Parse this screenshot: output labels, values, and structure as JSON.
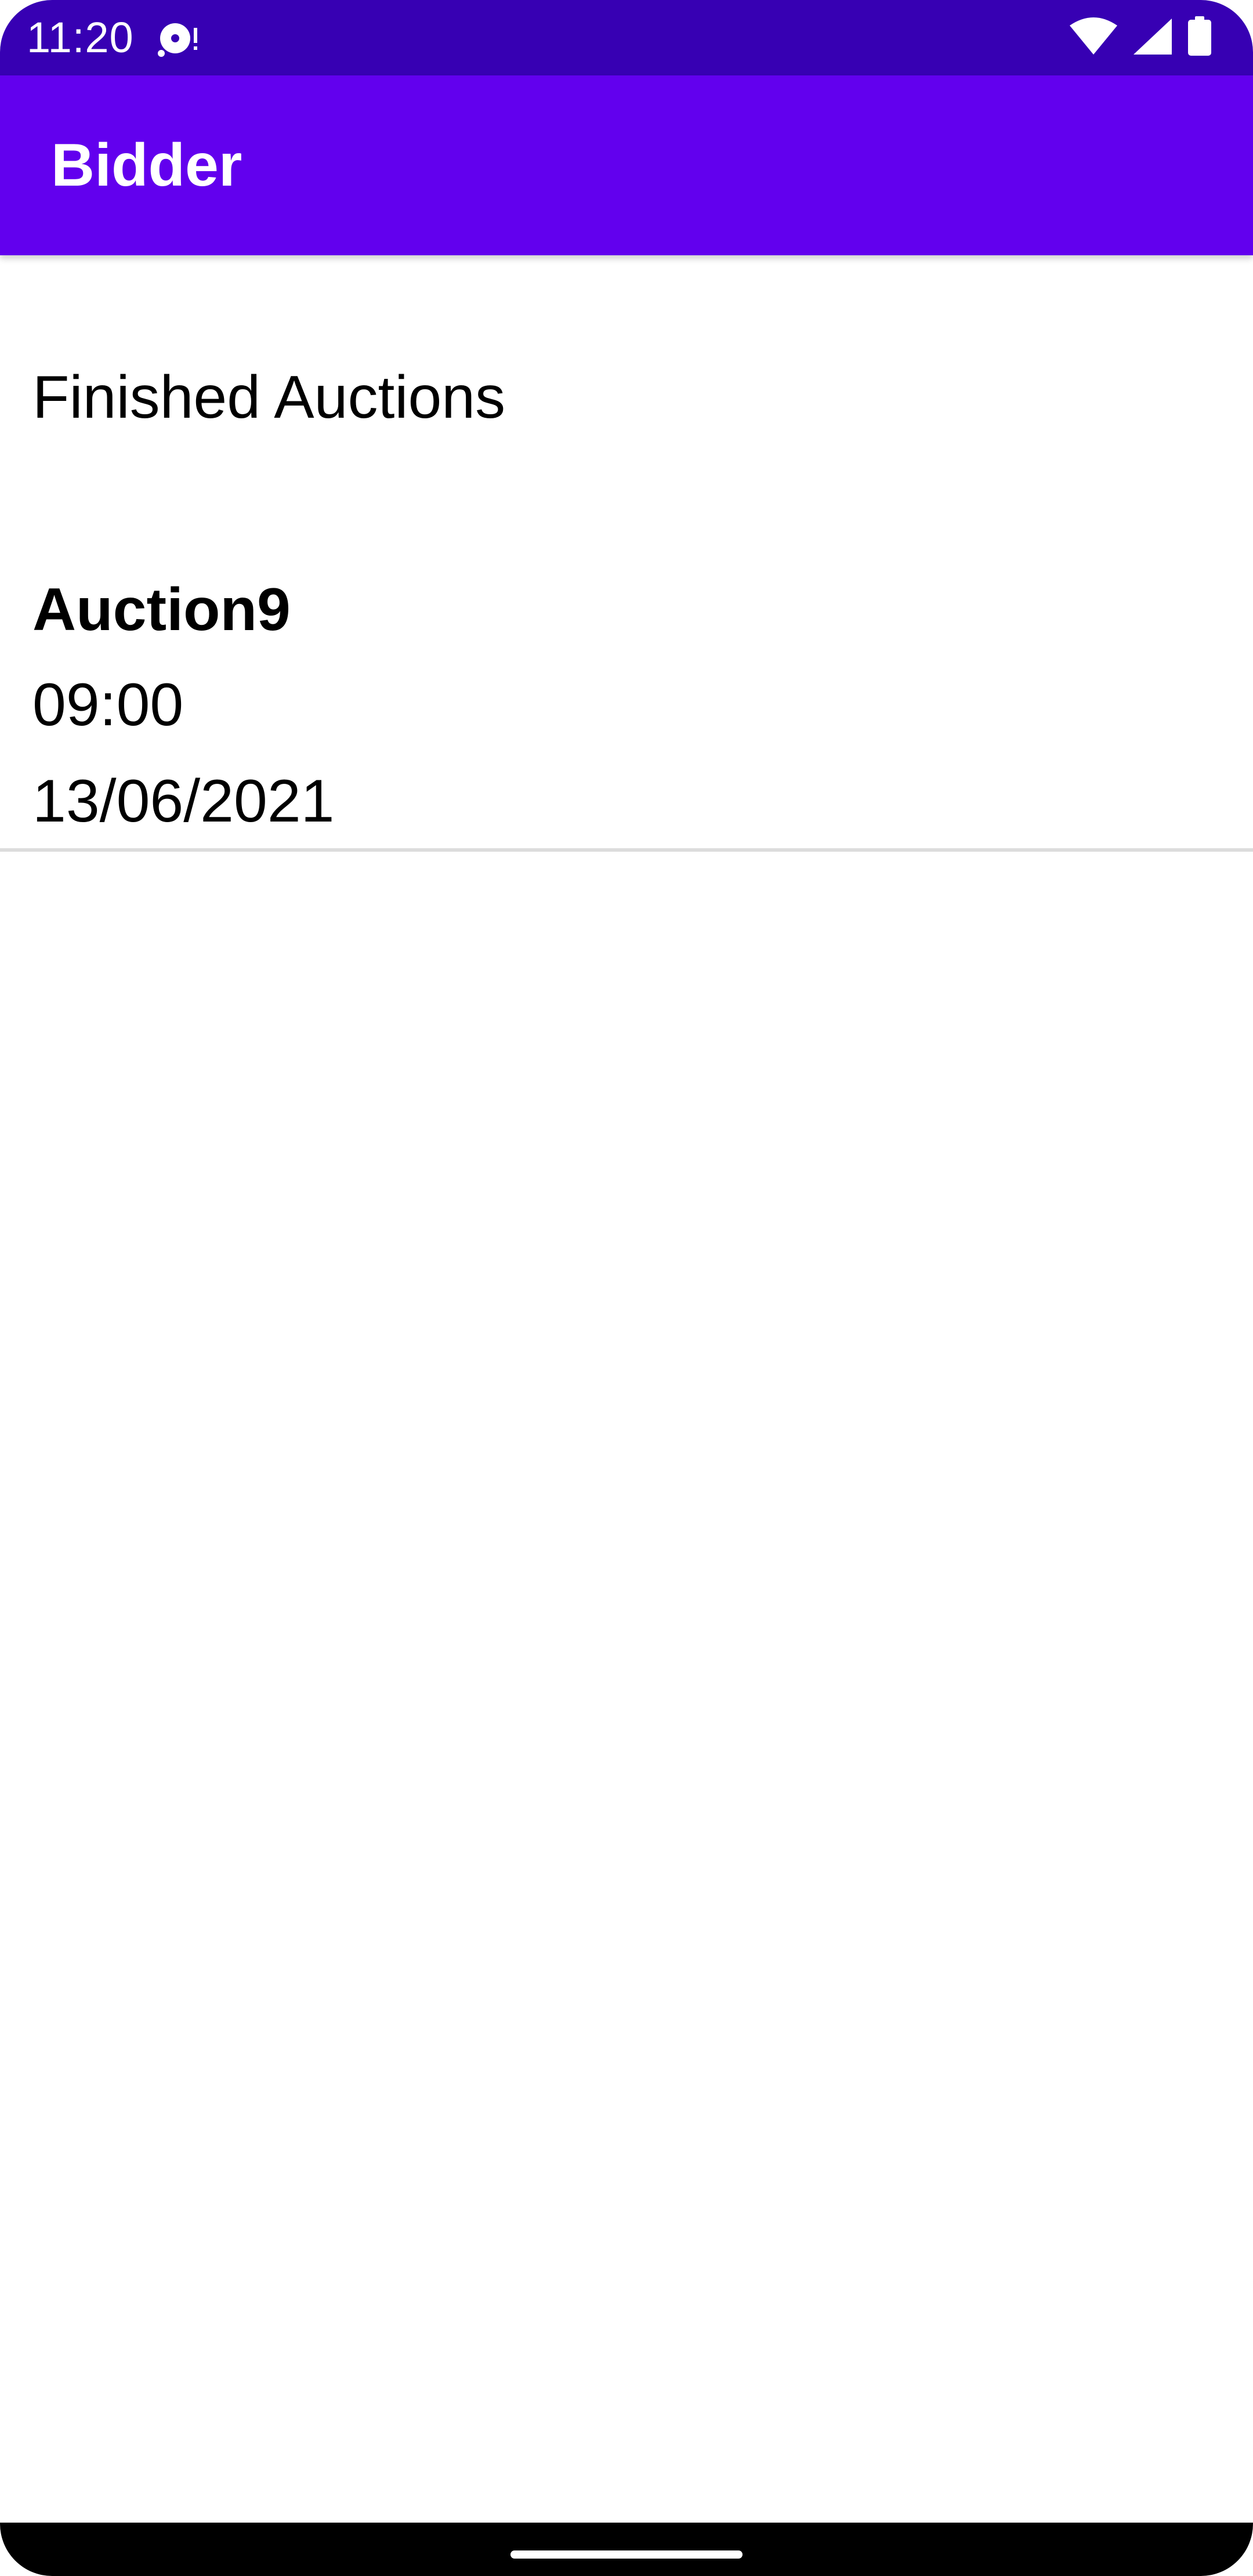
{
  "status_bar": {
    "time": "11:20",
    "icons": [
      "media-sync-icon",
      "wifi-icon",
      "cellular-signal-icon",
      "battery-icon"
    ]
  },
  "app_bar": {
    "title": "Bidder"
  },
  "main": {
    "section_title": "Finished Auctions",
    "auctions": [
      {
        "name": "Auction9",
        "time": "09:00",
        "date": "13/06/2021"
      }
    ]
  },
  "colors": {
    "status_bar": "#3700B3",
    "app_bar": "#6200EE",
    "background": "#FFFFFF",
    "divider": "#DCDCDC"
  }
}
